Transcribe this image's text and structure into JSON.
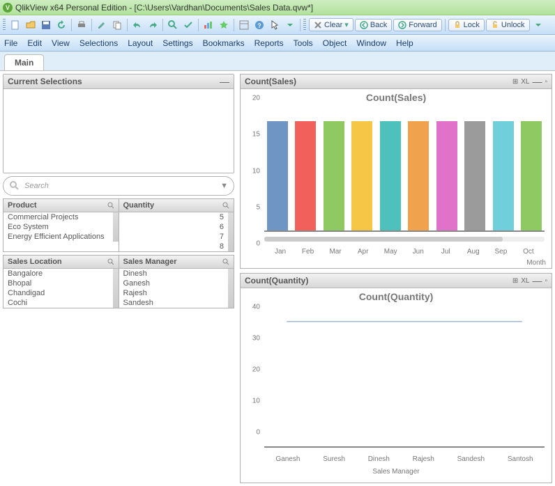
{
  "title": "QlikView x64 Personal Edition - [C:\\Users\\Vardhan\\Documents\\Sales Data.qvw*]",
  "toolbar": {
    "clear": "Clear",
    "back": "Back",
    "forward": "Forward",
    "lock": "Lock",
    "unlock": "Unlock"
  },
  "menu": {
    "file": "File",
    "edit": "Edit",
    "view": "View",
    "selections": "Selections",
    "layout": "Layout",
    "settings": "Settings",
    "bookmarks": "Bookmarks",
    "reports": "Reports",
    "tools": "Tools",
    "object": "Object",
    "window": "Window",
    "help": "Help"
  },
  "tab": {
    "main": "Main"
  },
  "left": {
    "cursel": "Current Selections",
    "search_placeholder": "Search",
    "product": {
      "title": "Product",
      "items": [
        "Commercial Projects",
        "Eco System",
        "Energy Efficient Applications"
      ]
    },
    "quantity": {
      "title": "Quantity",
      "items": [
        "5",
        "6",
        "7",
        "8"
      ]
    },
    "location": {
      "title": "Sales Location",
      "items": [
        "Bangalore",
        "Bhopal",
        "Chandigad",
        "Cochi"
      ]
    },
    "manager": {
      "title": "Sales Manager",
      "items": [
        "Dinesh",
        "Ganesh",
        "Rajesh",
        "Sandesh"
      ]
    }
  },
  "chart_sales": {
    "header": "Count(Sales)",
    "title": "Count(Sales)",
    "badge": "XL",
    "xlabel": "Month"
  },
  "chart_qty": {
    "header": "Count(Quantity)",
    "title": "Count(Quantity)",
    "badge": "XL",
    "xlabel": "Sales Manager"
  },
  "chart_data": [
    {
      "type": "bar",
      "title": "Count(Sales)",
      "xlabel": "Month",
      "ylabel": "",
      "ylim": [
        0,
        20
      ],
      "yticks": [
        0,
        5,
        10,
        15,
        20
      ],
      "categories": [
        "Jan",
        "Feb",
        "Mar",
        "Apr",
        "May",
        "Jun",
        "Jul",
        "Aug",
        "Sep",
        "Oct"
      ],
      "values": [
        18,
        18,
        18,
        18,
        18,
        18,
        18,
        18,
        18,
        18
      ],
      "colors": [
        "#6f95c4",
        "#f1605a",
        "#8fc962",
        "#f6c646",
        "#4fc1bc",
        "#f1a24d",
        "#e172c9",
        "#9b9b9b",
        "#6fd0dc",
        "#8fc962"
      ]
    },
    {
      "type": "line",
      "title": "Count(Quantity)",
      "xlabel": "Sales Manager",
      "ylabel": "",
      "ylim": [
        0,
        40
      ],
      "yticks": [
        0,
        10,
        20,
        30,
        40
      ],
      "categories": [
        "Ganesh",
        "Suresh",
        "Dinesh",
        "Rajesh",
        "Sandesh",
        "Santosh"
      ],
      "values": [
        36,
        36,
        36,
        36,
        36,
        36
      ],
      "color": "#6f95c4"
    }
  ]
}
